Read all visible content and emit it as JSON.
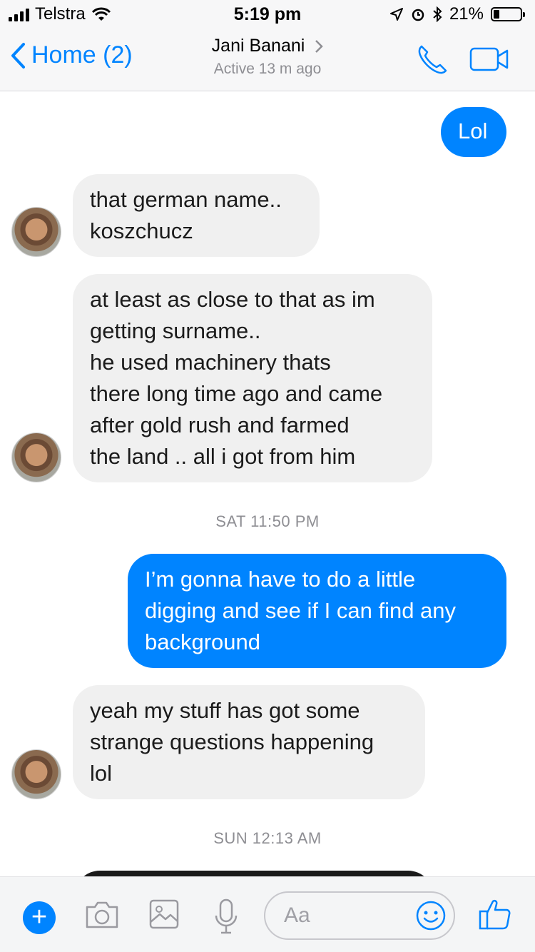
{
  "status_bar": {
    "carrier": "Telstra",
    "time": "5:19 pm",
    "battery_percent": "21%",
    "battery_level": 0.21
  },
  "header": {
    "back_label": "Home (2)",
    "contact_name": "Jani Banani",
    "status": "Active 13 m ago",
    "accent_color": "#0084ff"
  },
  "messages": [
    {
      "direction": "out",
      "text": "Lol"
    },
    {
      "direction": "in",
      "text": "that german name..\nkoszchucz"
    },
    {
      "direction": "in",
      "text": "at least as close to that as im\ngetting surname..\nhe used machinery thats\nthere long time ago and came\nafter gold rush and farmed\nthe land .. all i got from him"
    },
    {
      "type": "timestamp",
      "text": "SAT 11:50 PM"
    },
    {
      "direction": "out",
      "text": "I’m gonna have to do a little\ndigging and see if I can find any\nbackground"
    },
    {
      "direction": "in",
      "text": "yeah my stuff has got some\nstrange questions happening\nlol"
    },
    {
      "type": "timestamp",
      "text": "SUN 12:13 AM"
    }
  ],
  "composer": {
    "placeholder": "Aa",
    "icons": [
      "plus-icon",
      "camera-icon",
      "gallery-icon",
      "microphone-icon",
      "emoji-icon",
      "thumbs-up-icon"
    ]
  }
}
